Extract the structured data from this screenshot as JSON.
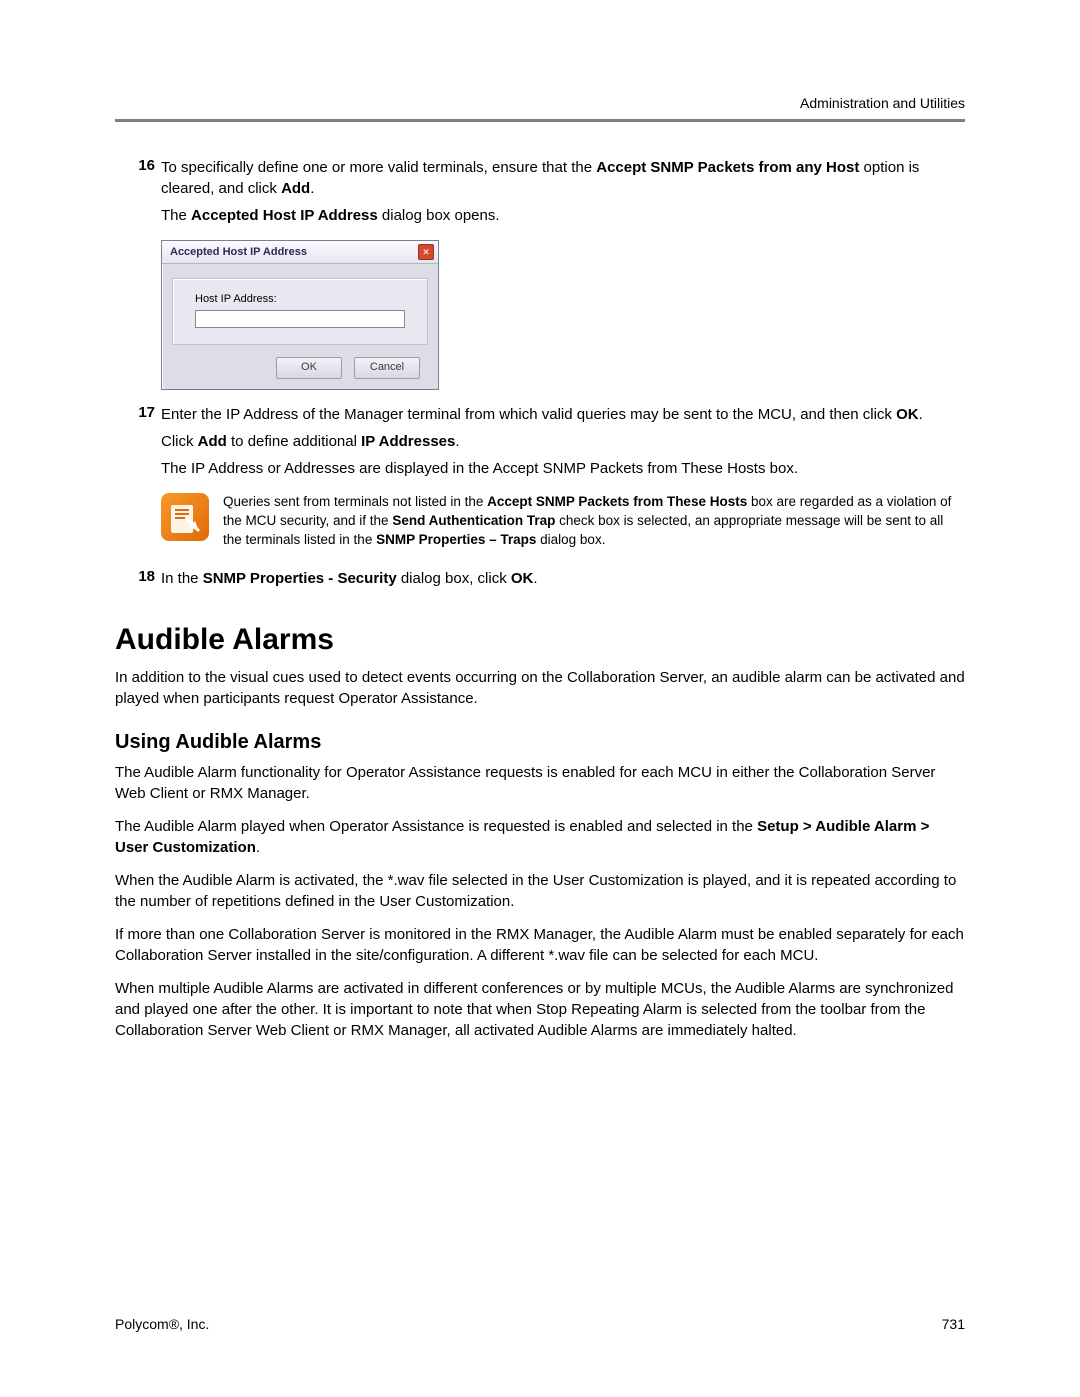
{
  "header": {
    "right": "Administration and Utilities"
  },
  "steps": {
    "s16": {
      "num": "16",
      "text_1a": "To specifically define one or more valid terminals, ensure that the ",
      "bold_1": "Accept SNMP Packets from any Host",
      "text_1b": " option is cleared, and click ",
      "bold_2": "Add",
      "text_1c": ".",
      "line2a": "The ",
      "line2_bold": "Accepted Host IP Address",
      "line2b": " dialog box opens."
    },
    "s17": {
      "num": "17",
      "text_1": "Enter the IP Address of the Manager terminal from which valid queries may be sent to the MCU, and then click ",
      "bold_ok": "OK",
      "text_1b": ".",
      "line2a": "Click ",
      "line2_bold1": "Add",
      "line2b": " to define additional ",
      "line2_bold2": "IP Addresses",
      "line2c": ".",
      "line3": "The IP Address or Addresses are displayed in the Accept SNMP Packets from These Hosts box."
    },
    "s18": {
      "num": "18",
      "text_a": "In the ",
      "bold_1": "SNMP Properties - Security",
      "text_b": " dialog box, click ",
      "bold_2": "OK",
      "text_c": "."
    }
  },
  "dialog": {
    "title": "Accepted Host IP Address",
    "close_glyph": "✕",
    "label": "Host IP Address:",
    "input_value": "",
    "ok": "OK",
    "cancel": "Cancel"
  },
  "note": {
    "t1": "Queries sent from terminals not listed in the ",
    "b1": "Accept SNMP Packets from These Hosts",
    "t2": " box are regarded as a violation of the MCU security, and if the ",
    "b2": "Send Authentication Trap",
    "t3": " check box is selected, an appropriate message will be sent to all the terminals listed in the ",
    "b3": "SNMP Properties – Traps",
    "t4": " dialog box."
  },
  "section_title": "Audible Alarms",
  "section_intro": "In addition to the visual cues used to detect events occurring on the Collaboration Server, an audible alarm can be activated and played when participants request Operator Assistance.",
  "sub_title": "Using Audible Alarms",
  "p1": "The Audible Alarm functionality for Operator Assistance requests is enabled for each MCU in either the Collaboration Server Web Client or RMX Manager.",
  "p2": {
    "a": "The Audible Alarm played when Operator Assistance is requested is enabled and selected in the ",
    "b": "Setup > Audible Alarm > User Customization",
    "c": "."
  },
  "p3": "When the Audible Alarm is activated, the *.wav file selected in the User Customization is played, and it is repeated according to the number of repetitions defined in the User Customization.",
  "p4": "If more than one Collaboration Server is monitored in the RMX Manager, the Audible Alarm must be enabled separately for each Collaboration Server installed in the site/configuration. A different *.wav file can be selected for each MCU.",
  "p5": "When multiple Audible Alarms are activated in different conferences or by multiple MCUs, the Audible Alarms are synchronized and played one after the other. It is important to note that when Stop Repeating Alarm is selected from the toolbar from the Collaboration Server Web Client or RMX Manager, all activated Audible Alarms are immediately halted.",
  "footer": {
    "left_a": "Polycom",
    "reg": "®",
    "left_b": ", Inc.",
    "page": "731"
  }
}
